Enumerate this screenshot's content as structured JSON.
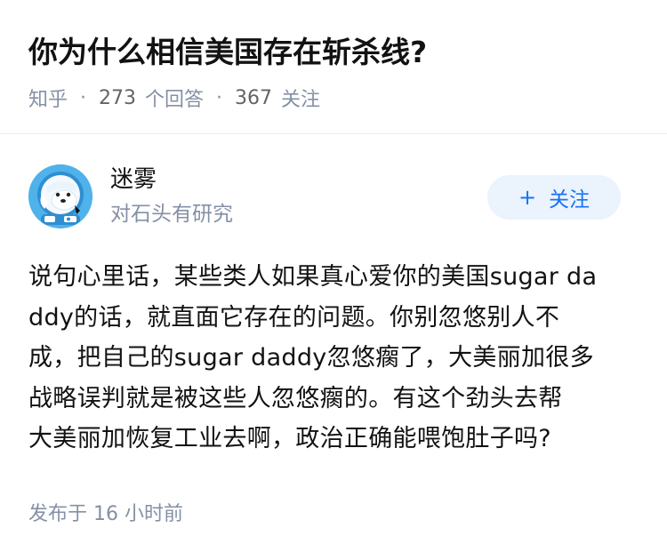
{
  "question": {
    "title": "你为什么相信美国存在斩杀线?",
    "source": "知乎",
    "answers_count": "273",
    "answers_label": "个回答",
    "followers_count": "367",
    "followers_label": "关注"
  },
  "author": {
    "name": "迷雾",
    "bio": "对石头有研究",
    "avatar_icon": "dog-astronaut-avatar-icon",
    "follow_button_label": "关注",
    "follow_button_icon": "plus-icon"
  },
  "answer": {
    "lines": [
      "说句心里话，某些类人如果真心爱你的美国sugar da",
      "ddy的话，就直面它存在的问题。你别忽悠别人不",
      "成，把自己的sugar daddy忽悠瘸了，大美丽加很多",
      "战略误判就是被这些人忽悠瘸的。有这个劲头去帮",
      "大美丽加恢复工业去啊，政治正确能喂饱肚子吗?"
    ]
  },
  "footer": {
    "published_label": "发布于",
    "time_value": "16 小时前"
  },
  "colors": {
    "accent": "#1772f6",
    "follow_bg": "#ebf3fc",
    "muted_text": "#8590a6",
    "avatar_bg": "#4fb2ea"
  }
}
